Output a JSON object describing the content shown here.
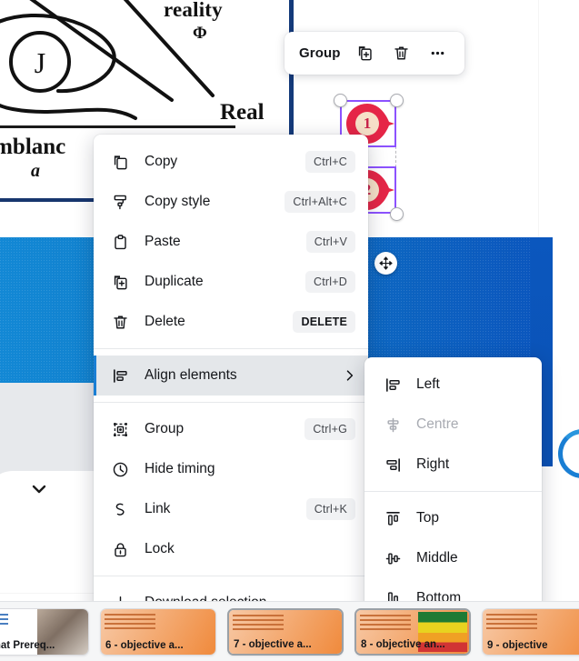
{
  "canvas": {
    "diagram_words": {
      "reality": "reality",
      "phi": "Φ",
      "real": "Real",
      "semblance": "emblanc",
      "a": "a",
      "j_letter": "J"
    },
    "markers": [
      {
        "number": "1"
      },
      {
        "number": "2"
      }
    ],
    "move_handle_icon": "move-icon"
  },
  "toolbar": {
    "group_label": "Group",
    "duplicate_icon": "duplicate-icon",
    "delete_icon": "trash-icon",
    "more_icon": "ellipsis-icon"
  },
  "context_menu": {
    "groups": [
      {
        "items": [
          {
            "icon": "copy-icon",
            "label": "Copy",
            "shortcut": "Ctrl+C",
            "state": "normal"
          },
          {
            "icon": "paint-roller-icon",
            "label": "Copy style",
            "shortcut": "Ctrl+Alt+C",
            "state": "normal"
          },
          {
            "icon": "clipboard-icon",
            "label": "Paste",
            "shortcut": "Ctrl+V",
            "state": "normal"
          },
          {
            "icon": "duplicate-icon",
            "label": "Duplicate",
            "shortcut": "Ctrl+D",
            "state": "normal"
          },
          {
            "icon": "trash-icon",
            "label": "Delete",
            "shortcut": "DELETE",
            "state": "normal",
            "shortcut_strong": true
          }
        ]
      },
      {
        "items": [
          {
            "icon": "align-left-icon",
            "label": "Align elements",
            "shortcut": "",
            "state": "active",
            "submenu": true
          }
        ]
      },
      {
        "items": [
          {
            "icon": "group-icon",
            "label": "Group",
            "shortcut": "Ctrl+G",
            "state": "normal"
          },
          {
            "icon": "clock-icon",
            "label": "Hide timing",
            "shortcut": "",
            "state": "normal"
          },
          {
            "icon": "link-icon",
            "label": "Link",
            "shortcut": "Ctrl+K",
            "state": "normal"
          },
          {
            "icon": "lock-icon",
            "label": "Lock",
            "shortcut": "",
            "state": "normal"
          }
        ]
      },
      {
        "items": [
          {
            "icon": "download-icon",
            "label": "Download selection",
            "shortcut": "",
            "state": "normal"
          }
        ]
      }
    ]
  },
  "submenu": {
    "groups": [
      {
        "items": [
          {
            "icon": "align-left-icon",
            "label": "Left",
            "state": "normal"
          },
          {
            "icon": "align-centre-icon",
            "label": "Centre",
            "state": "disabled"
          },
          {
            "icon": "align-right-icon",
            "label": "Right",
            "state": "normal"
          }
        ]
      },
      {
        "items": [
          {
            "icon": "align-top-icon",
            "label": "Top",
            "state": "normal"
          },
          {
            "icon": "align-middle-icon",
            "label": "Middle",
            "state": "normal"
          },
          {
            "icon": "align-bottom-icon",
            "label": "Bottom",
            "state": "normal"
          }
        ]
      }
    ]
  },
  "slide_strip": {
    "thumbnails": [
      {
        "label": "- What Prereq...",
        "style": "photo",
        "selected": false
      },
      {
        "label": "6 - objective a...",
        "style": "orange",
        "selected": false
      },
      {
        "label": "7 - objective a...",
        "style": "orange",
        "selected": true
      },
      {
        "label": "8 - objective an...",
        "style": "chart",
        "selected": true
      },
      {
        "label": "9 - objective",
        "style": "orange",
        "selected": false
      }
    ]
  },
  "colors": {
    "accent_blue": "#1a7fd4",
    "deep_blue": "#0b57be",
    "navy": "#17366e",
    "selection_purple": "#8c52ff",
    "marker_red": "#e52647",
    "marker_fill": "#f6e0c8"
  }
}
